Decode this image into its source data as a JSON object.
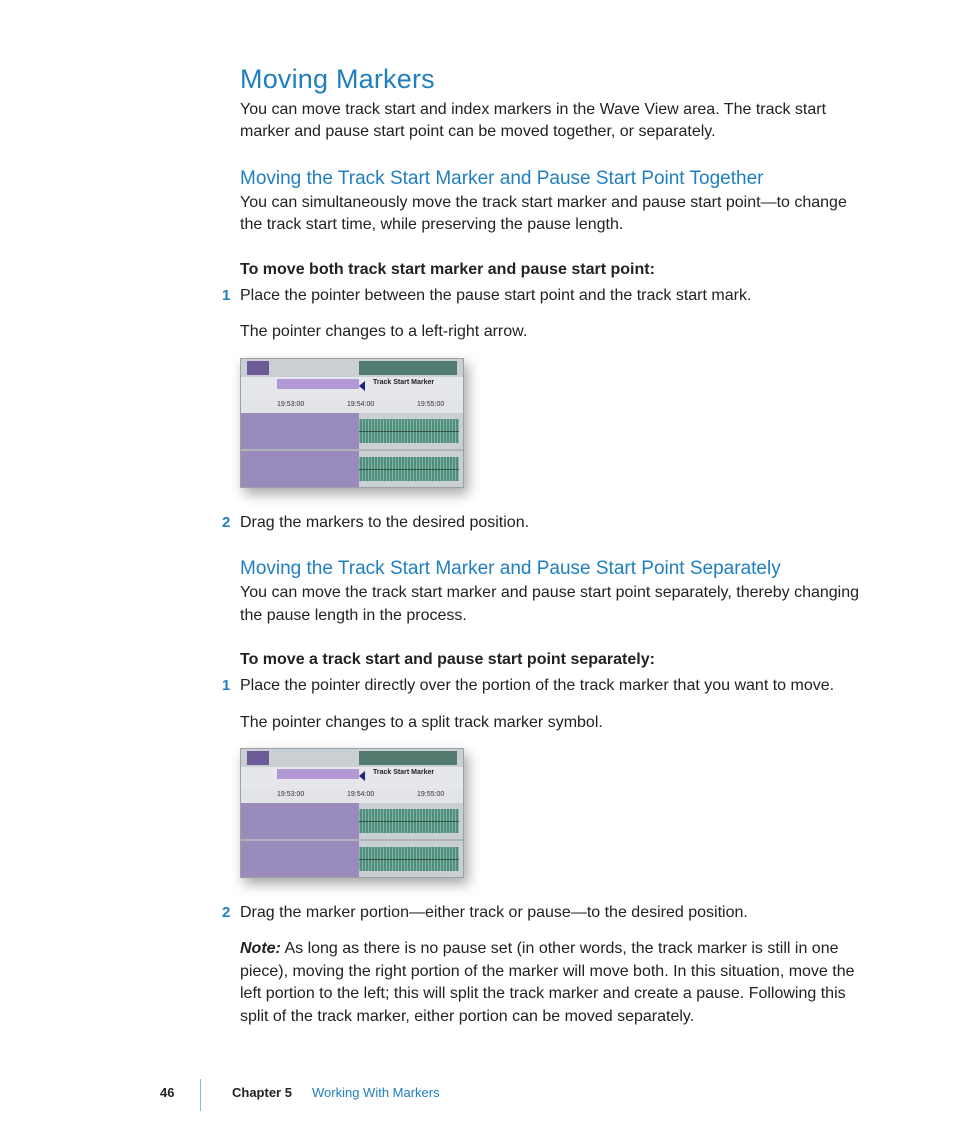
{
  "h1": "Moving Markers",
  "intro": "You can move track start and index markers in the Wave View area. The track start marker and pause start point can be moved together, or separately.",
  "section1": {
    "heading": "Moving the Track Start Marker and Pause Start Point Together",
    "lead": "You can simultaneously move the track start marker and pause start point—to change the track start time, while preserving the pause length.",
    "procTitle": "To move both track start marker and pause start point:",
    "step1num": "1",
    "step1": "Place the pointer between the pause start point and the track start mark.",
    "step1b": "The pointer changes to a left-right arrow.",
    "step2num": "2",
    "step2": "Drag the markers to the desired position."
  },
  "section2": {
    "heading": "Moving the Track Start Marker and Pause Start Point Separately",
    "lead": "You can move the track start marker and pause start point separately, thereby changing the pause length in the process.",
    "procTitle": "To move a track start and pause start point separately:",
    "step1num": "1",
    "step1": "Place the pointer directly over the portion of the track marker that you want to move.",
    "step1b": "The pointer changes to a split track marker symbol.",
    "step2num": "2",
    "step2": "Drag the marker portion—either track or pause—to the desired position.",
    "noteLabel": "Note:",
    "note": "  As long as there is no pause set (in other words, the track marker is still in one piece), moving the right portion of the marker will move both. In this situation, move the left portion to the left; this will split the track marker and create a pause. Following this split of the track marker, either portion can be moved separately."
  },
  "figure": {
    "markerLabel": "Track Start Marker",
    "time1": "19:53:00",
    "time2": "19:54:00",
    "time3": "19:55:00"
  },
  "footer": {
    "page": "46",
    "chapter": "Chapter 5",
    "title": "Working With Markers"
  }
}
